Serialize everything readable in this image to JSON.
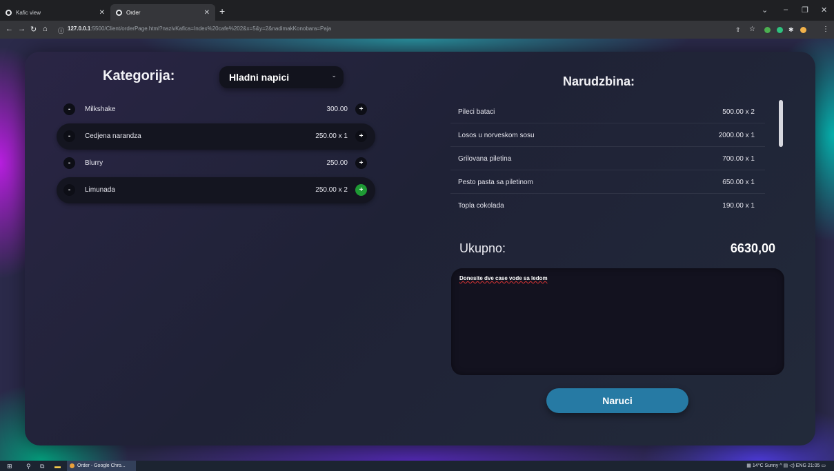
{
  "browser": {
    "tabs": [
      {
        "title": "Kafic view"
      },
      {
        "title": "Order"
      }
    ],
    "url_host": "127.0.0.1",
    "url_rest": ":5500/Client/orderPage.html?nazivKafica=Index%20cafe%202&x=5&y=2&nadimakKonobara=Paja"
  },
  "menu": {
    "label": "Kategorija:",
    "selected_category": "Hladni napici",
    "items": [
      {
        "name": "Milkshake",
        "price": "300.00",
        "selected": false
      },
      {
        "name": "Cedjena narandza",
        "price": "250.00 x 1",
        "selected": true
      },
      {
        "name": "Blurry",
        "price": "250.00",
        "selected": false
      },
      {
        "name": "Limunada",
        "price": "250.00 x 2",
        "selected": true
      }
    ]
  },
  "order": {
    "title": "Narudzbina:",
    "items": [
      {
        "name": "Pileci bataci",
        "qty": "500.00 x 2"
      },
      {
        "name": "Losos u norveskom sosu",
        "qty": "2000.00 x 1"
      },
      {
        "name": "Grilovana piletina",
        "qty": "700.00 x 1"
      },
      {
        "name": "Pesto pasta sa piletinom",
        "qty": "650.00 x 1"
      },
      {
        "name": "Topla cokolada",
        "qty": "190.00 x 1"
      }
    ],
    "total_label": "Ukupno:",
    "total_value": "6630,00",
    "note": "Donesite dve case vode sa ledom",
    "submit_label": "Naruci"
  },
  "taskbar": {
    "app_label": "Order - Google Chro...",
    "weather": "14°C Sunny",
    "language": "ENG",
    "time": "21:05"
  },
  "colors": {
    "accent_button": "#267aa4",
    "active_plus": "#1e9a34"
  }
}
